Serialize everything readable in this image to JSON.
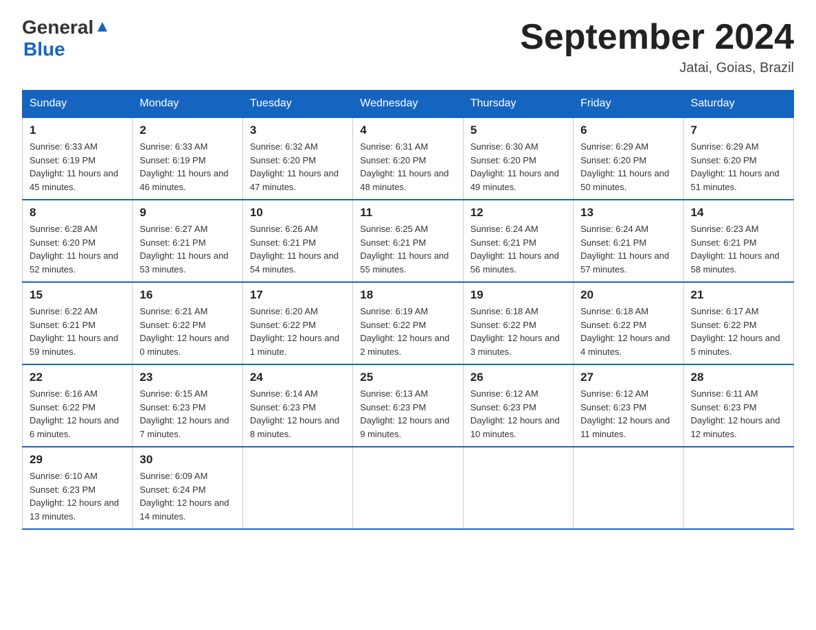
{
  "header": {
    "logo_general": "General",
    "logo_blue": "Blue",
    "title": "September 2024",
    "subtitle": "Jatai, Goias, Brazil"
  },
  "weekdays": [
    "Sunday",
    "Monday",
    "Tuesday",
    "Wednesday",
    "Thursday",
    "Friday",
    "Saturday"
  ],
  "weeks": [
    [
      {
        "day": "1",
        "sunrise": "6:33 AM",
        "sunset": "6:19 PM",
        "daylight": "11 hours and 45 minutes."
      },
      {
        "day": "2",
        "sunrise": "6:33 AM",
        "sunset": "6:19 PM",
        "daylight": "11 hours and 46 minutes."
      },
      {
        "day": "3",
        "sunrise": "6:32 AM",
        "sunset": "6:20 PM",
        "daylight": "11 hours and 47 minutes."
      },
      {
        "day": "4",
        "sunrise": "6:31 AM",
        "sunset": "6:20 PM",
        "daylight": "11 hours and 48 minutes."
      },
      {
        "day": "5",
        "sunrise": "6:30 AM",
        "sunset": "6:20 PM",
        "daylight": "11 hours and 49 minutes."
      },
      {
        "day": "6",
        "sunrise": "6:29 AM",
        "sunset": "6:20 PM",
        "daylight": "11 hours and 50 minutes."
      },
      {
        "day": "7",
        "sunrise": "6:29 AM",
        "sunset": "6:20 PM",
        "daylight": "11 hours and 51 minutes."
      }
    ],
    [
      {
        "day": "8",
        "sunrise": "6:28 AM",
        "sunset": "6:20 PM",
        "daylight": "11 hours and 52 minutes."
      },
      {
        "day": "9",
        "sunrise": "6:27 AM",
        "sunset": "6:21 PM",
        "daylight": "11 hours and 53 minutes."
      },
      {
        "day": "10",
        "sunrise": "6:26 AM",
        "sunset": "6:21 PM",
        "daylight": "11 hours and 54 minutes."
      },
      {
        "day": "11",
        "sunrise": "6:25 AM",
        "sunset": "6:21 PM",
        "daylight": "11 hours and 55 minutes."
      },
      {
        "day": "12",
        "sunrise": "6:24 AM",
        "sunset": "6:21 PM",
        "daylight": "11 hours and 56 minutes."
      },
      {
        "day": "13",
        "sunrise": "6:24 AM",
        "sunset": "6:21 PM",
        "daylight": "11 hours and 57 minutes."
      },
      {
        "day": "14",
        "sunrise": "6:23 AM",
        "sunset": "6:21 PM",
        "daylight": "11 hours and 58 minutes."
      }
    ],
    [
      {
        "day": "15",
        "sunrise": "6:22 AM",
        "sunset": "6:21 PM",
        "daylight": "11 hours and 59 minutes."
      },
      {
        "day": "16",
        "sunrise": "6:21 AM",
        "sunset": "6:22 PM",
        "daylight": "12 hours and 0 minutes."
      },
      {
        "day": "17",
        "sunrise": "6:20 AM",
        "sunset": "6:22 PM",
        "daylight": "12 hours and 1 minute."
      },
      {
        "day": "18",
        "sunrise": "6:19 AM",
        "sunset": "6:22 PM",
        "daylight": "12 hours and 2 minutes."
      },
      {
        "day": "19",
        "sunrise": "6:18 AM",
        "sunset": "6:22 PM",
        "daylight": "12 hours and 3 minutes."
      },
      {
        "day": "20",
        "sunrise": "6:18 AM",
        "sunset": "6:22 PM",
        "daylight": "12 hours and 4 minutes."
      },
      {
        "day": "21",
        "sunrise": "6:17 AM",
        "sunset": "6:22 PM",
        "daylight": "12 hours and 5 minutes."
      }
    ],
    [
      {
        "day": "22",
        "sunrise": "6:16 AM",
        "sunset": "6:22 PM",
        "daylight": "12 hours and 6 minutes."
      },
      {
        "day": "23",
        "sunrise": "6:15 AM",
        "sunset": "6:23 PM",
        "daylight": "12 hours and 7 minutes."
      },
      {
        "day": "24",
        "sunrise": "6:14 AM",
        "sunset": "6:23 PM",
        "daylight": "12 hours and 8 minutes."
      },
      {
        "day": "25",
        "sunrise": "6:13 AM",
        "sunset": "6:23 PM",
        "daylight": "12 hours and 9 minutes."
      },
      {
        "day": "26",
        "sunrise": "6:12 AM",
        "sunset": "6:23 PM",
        "daylight": "12 hours and 10 minutes."
      },
      {
        "day": "27",
        "sunrise": "6:12 AM",
        "sunset": "6:23 PM",
        "daylight": "12 hours and 11 minutes."
      },
      {
        "day": "28",
        "sunrise": "6:11 AM",
        "sunset": "6:23 PM",
        "daylight": "12 hours and 12 minutes."
      }
    ],
    [
      {
        "day": "29",
        "sunrise": "6:10 AM",
        "sunset": "6:23 PM",
        "daylight": "12 hours and 13 minutes."
      },
      {
        "day": "30",
        "sunrise": "6:09 AM",
        "sunset": "6:24 PM",
        "daylight": "12 hours and 14 minutes."
      },
      null,
      null,
      null,
      null,
      null
    ]
  ],
  "labels": {
    "sunrise": "Sunrise:",
    "sunset": "Sunset:",
    "daylight": "Daylight:"
  }
}
